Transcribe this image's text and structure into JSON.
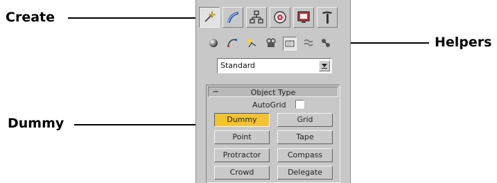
{
  "callouts": {
    "create": "Create",
    "helpers": "Helpers",
    "dummy": "Dummy"
  },
  "panel": {
    "tabs": [
      {
        "icon": "create-icon",
        "active": true
      },
      {
        "icon": "modify-icon",
        "active": false
      },
      {
        "icon": "hierarchy-icon",
        "active": false
      },
      {
        "icon": "motion-icon",
        "active": false
      },
      {
        "icon": "display-icon",
        "active": false
      },
      {
        "icon": "utilities-icon",
        "active": false
      }
    ],
    "categories": [
      {
        "icon": "geometry-icon",
        "active": false
      },
      {
        "icon": "shapes-icon",
        "active": false
      },
      {
        "icon": "lights-icon",
        "active": false
      },
      {
        "icon": "cameras-icon",
        "active": false
      },
      {
        "icon": "helpers-icon",
        "active": true
      },
      {
        "icon": "space-warps-icon",
        "active": false
      },
      {
        "icon": "systems-icon",
        "active": false
      }
    ],
    "dropdown": {
      "value": "Standard"
    },
    "rollout": {
      "toggle": "−",
      "title": "Object Type",
      "autogrid_label": "AutoGrid",
      "autogrid_checked": false,
      "buttons": [
        "Dummy",
        "Grid",
        "Point",
        "Tape",
        "Protractor",
        "Compass",
        "Crowd",
        "Delegate"
      ],
      "pressed_button": "Dummy"
    }
  },
  "colors": {
    "panel_bg": "#c8c8c8",
    "pressed_button": "#f2c431"
  }
}
